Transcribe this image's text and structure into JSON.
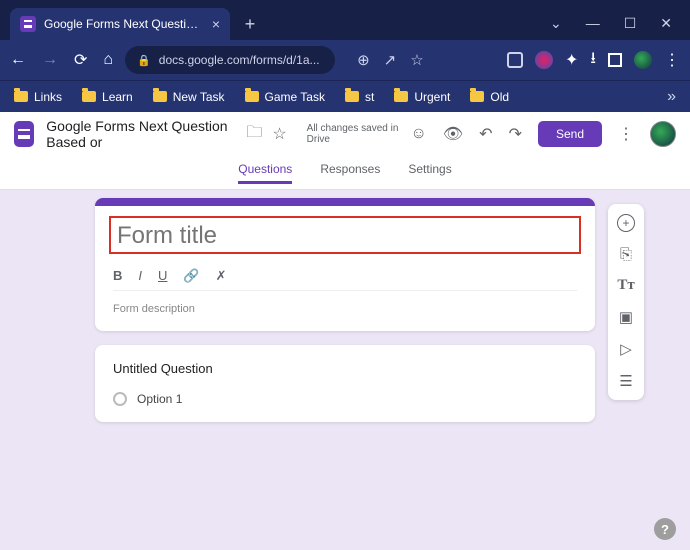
{
  "browser": {
    "tab_title": "Google Forms Next Question Bas…",
    "url_display": "docs.google.com/forms/d/1a...",
    "bookmarks": [
      "Links",
      "Learn",
      "New Task",
      "Game Task",
      "st",
      "Urgent",
      "Old"
    ]
  },
  "header": {
    "doc_title": "Google Forms Next Question Based or",
    "save_status": "All changes saved in Drive",
    "send_label": "Send"
  },
  "tabs": {
    "questions": "Questions",
    "responses": "Responses",
    "settings": "Settings"
  },
  "form": {
    "title_placeholder": "Form title",
    "description_placeholder": "Form description"
  },
  "question": {
    "title": "Untitled Question",
    "option1": "Option 1"
  },
  "help": {
    "label": "?"
  }
}
